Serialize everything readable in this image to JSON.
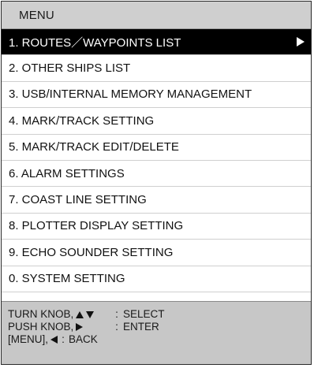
{
  "header": {
    "title": "MENU"
  },
  "menu": {
    "items": [
      {
        "label": "1. ROUTES／WAYPOINTS LIST",
        "selected": true
      },
      {
        "label": "2. OTHER SHIPS LIST",
        "selected": false
      },
      {
        "label": "3. USB/INTERNAL MEMORY MANAGEMENT",
        "selected": false
      },
      {
        "label": "4. MARK/TRACK SETTING",
        "selected": false
      },
      {
        "label": "5. MARK/TRACK EDIT/DELETE",
        "selected": false
      },
      {
        "label": "6. ALARM SETTINGS",
        "selected": false
      },
      {
        "label": "7. COAST LINE SETTING",
        "selected": false
      },
      {
        "label": "8. PLOTTER DISPLAY SETTING",
        "selected": false
      },
      {
        "label": "9. ECHO SOUNDER SETTING",
        "selected": false
      },
      {
        "label": "0. SYSTEM SETTING",
        "selected": false
      }
    ],
    "selected_arrow_icon": "triangle-right-icon"
  },
  "footer": {
    "help": [
      {
        "key": "TURN KNOB,",
        "icons": [
          "triangle-up-icon",
          "triangle-down-icon"
        ],
        "sep": ":",
        "action": "SELECT"
      },
      {
        "key": "PUSH KNOB,",
        "icons": [
          "triangle-right-icon"
        ],
        "sep": ":",
        "action": "ENTER"
      },
      {
        "key": "[MENU],",
        "icons": [
          "triangle-left-icon"
        ],
        "sep": ":",
        "action": "BACK"
      }
    ]
  }
}
